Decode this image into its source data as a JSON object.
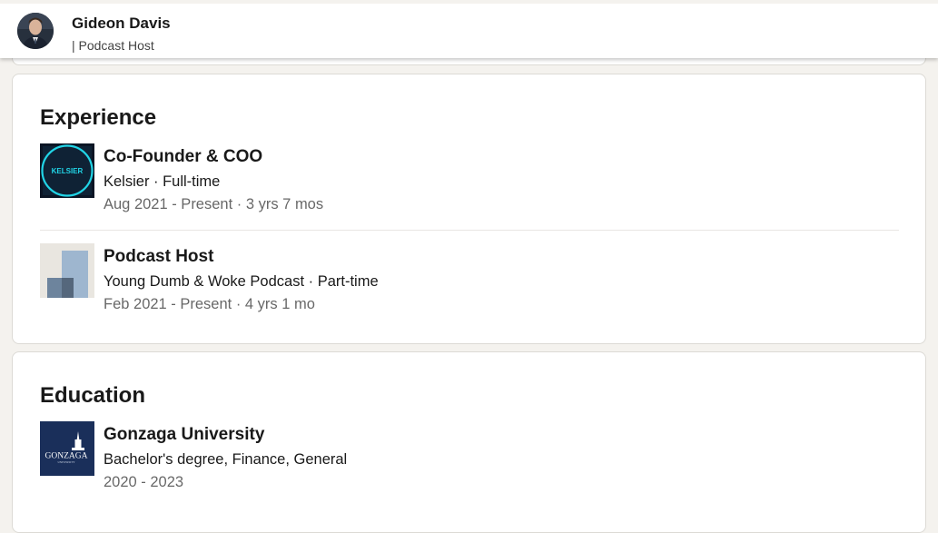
{
  "header": {
    "name": "Gideon Davis",
    "headline": "| Podcast Host"
  },
  "experience": {
    "title": "Experience",
    "items": [
      {
        "title": "Co-Founder & COO",
        "subtitle": "Kelsier · Full-time",
        "dates": "Aug 2021 - Present · 3 yrs 7 mos",
        "logo_text": "KELSIER"
      },
      {
        "title": "Podcast Host",
        "subtitle": "Young Dumb & Woke Podcast · Part-time",
        "dates": "Feb 2021 - Present · 4 yrs 1 mo"
      }
    ]
  },
  "education": {
    "title": "Education",
    "items": [
      {
        "title": "Gonzaga University",
        "subtitle": "Bachelor's degree, Finance, General",
        "dates": "2020 - 2023",
        "logo_text": "GONZAGA",
        "logo_subtext": "UNIVERSITY"
      }
    ]
  },
  "colors": {
    "page_bg": "#f4f2ee",
    "card_bg": "#ffffff",
    "kelsier_accent": "#21d4e6",
    "gonzaga_navy": "#1a2f5a"
  }
}
